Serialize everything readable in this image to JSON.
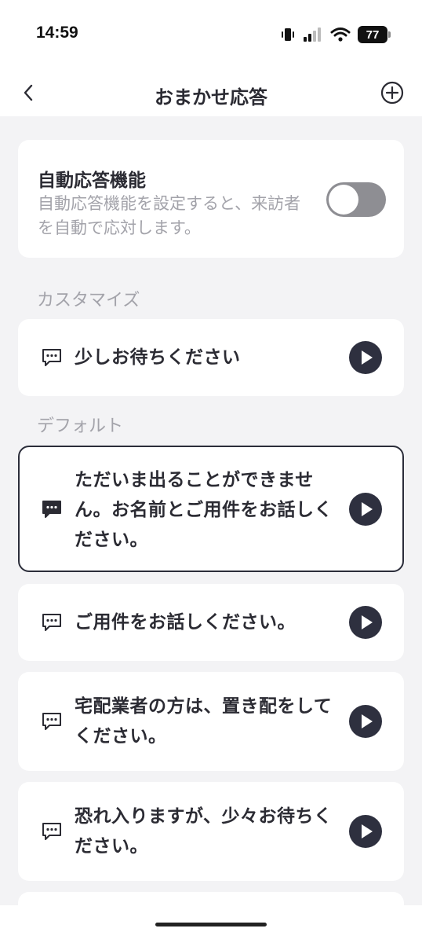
{
  "status_bar": {
    "time": "14:59",
    "battery": "77"
  },
  "nav": {
    "title": "おまかせ応答"
  },
  "auto_response": {
    "title": "自動応答機能",
    "description": "自動応答機能を設定すると、来訪者を自動で応対します。",
    "enabled": false
  },
  "sections": {
    "custom_label": "カスタマイズ",
    "default_label": "デフォルト"
  },
  "custom_messages": [
    {
      "text": "少しお待ちください"
    }
  ],
  "default_messages": [
    {
      "text": "ただいま出ることができません。お名前とご用件をお話しください。",
      "selected": true
    },
    {
      "text": "ご用件をお話しください。"
    },
    {
      "text": "宅配業者の方は、置き配をしてください。"
    },
    {
      "text": "恐れ入りますが、少々お待ちください。"
    }
  ],
  "colors": {
    "accent_dark": "#2e303f",
    "background": "#f3f3f5",
    "toggle_off": "#8e8e93",
    "muted_text": "#a3a3aa"
  },
  "icons": {
    "back": "chevron-left-icon",
    "add": "plus-circle-icon",
    "message": "speech-bubble-icon",
    "play": "play-icon"
  }
}
